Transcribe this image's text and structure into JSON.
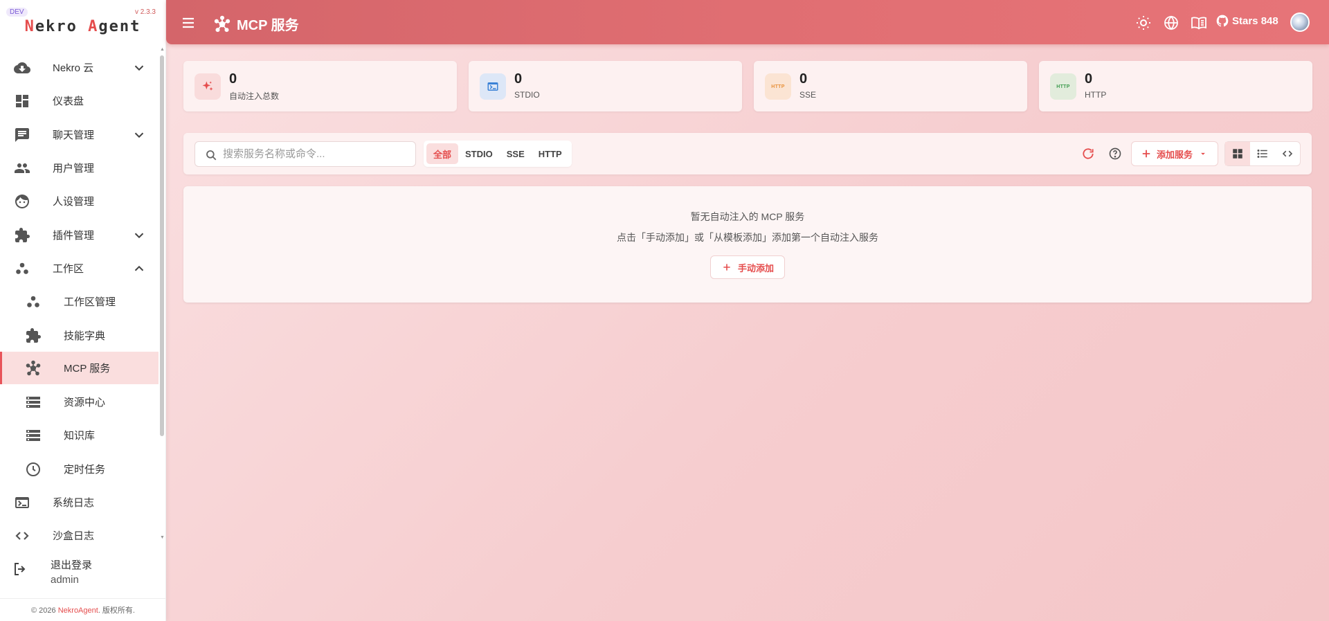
{
  "app": {
    "dev_badge": "DEV",
    "version": "v 2.3.3",
    "logo_first": "N",
    "logo_mid": "ekro ",
    "logo_accent": "A",
    "logo_rest": "gent"
  },
  "sidebar": {
    "items": [
      {
        "label": "Nekro 云",
        "icon": "cloud-download-icon",
        "expandable": true,
        "expanded": false
      },
      {
        "label": "仪表盘",
        "icon": "dashboard-icon"
      },
      {
        "label": "聊天管理",
        "icon": "chat-icon",
        "expandable": true,
        "expanded": false
      },
      {
        "label": "用户管理",
        "icon": "users-icon"
      },
      {
        "label": "人设管理",
        "icon": "face-icon"
      },
      {
        "label": "插件管理",
        "icon": "puzzle-icon",
        "expandable": true,
        "expanded": false
      },
      {
        "label": "工作区",
        "icon": "workspace-icon",
        "expandable": true,
        "expanded": true
      },
      {
        "label": "工作区管理",
        "icon": "workspace-icon"
      },
      {
        "label": "技能字典",
        "icon": "puzzle-icon"
      },
      {
        "label": "MCP 服务",
        "icon": "mcp-icon",
        "active": true
      },
      {
        "label": "资源中心",
        "icon": "storage-icon"
      },
      {
        "label": "知识库",
        "icon": "storage-icon"
      },
      {
        "label": "定时任务",
        "icon": "clock-icon"
      },
      {
        "label": "系统日志",
        "icon": "terminal-icon"
      },
      {
        "label": "沙盒日志",
        "icon": "code-icon"
      }
    ],
    "logout_label": "退出登录",
    "username": "admin",
    "copyright_prefix": "© 2026 ",
    "copyright_link": "NekroAgent",
    "copyright_suffix": ". 版权所有."
  },
  "header": {
    "title": "MCP 服务",
    "stars_label": "Stars 848"
  },
  "stats": [
    {
      "value": "0",
      "label": "自动注入总数",
      "icon": "sparkle-icon",
      "color": "#e54d4d",
      "bg": "#f9dcdc"
    },
    {
      "value": "0",
      "label": "STDIO",
      "icon": "terminal-icon",
      "color": "#3b82d6",
      "bg": "#dde7f7"
    },
    {
      "value": "0",
      "label": "SSE",
      "icon": "http-icon",
      "badge": "HTTP",
      "color": "#e8913a",
      "bg": "#fbe4d3"
    },
    {
      "value": "0",
      "label": "HTTP",
      "icon": "http-icon",
      "badge": "HTTP",
      "color": "#3e9b4f",
      "bg": "#e2ecdc"
    }
  ],
  "toolbar": {
    "search_placeholder": "搜索服务名称或命令...",
    "filters": [
      "全部",
      "STDIO",
      "SSE",
      "HTTP"
    ],
    "active_filter": "全部",
    "add_service_label": "添加服务"
  },
  "empty": {
    "title": "暂无自动注入的 MCP 服务",
    "subtitle": "点击「手动添加」或「从模板添加」添加第一个自动注入服务",
    "button_label": "手动添加"
  },
  "colors": {
    "accent": "#e54d4d",
    "header": "#e06e72",
    "active_bg": "#fadede"
  }
}
